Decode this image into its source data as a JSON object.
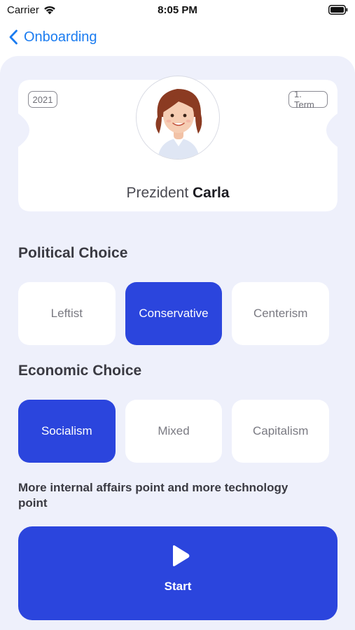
{
  "status_bar": {
    "carrier": "Carrier",
    "time": "8:05 PM"
  },
  "nav": {
    "back_label": "Onboarding"
  },
  "card": {
    "year": "2021",
    "term": "1. Term",
    "title_prefix": "Prezident",
    "name": "Carla",
    "avatar_icon": "woman-avatar-icon"
  },
  "political": {
    "title": "Political Choice",
    "options": [
      "Leftist",
      "Conservative",
      "Centerism"
    ],
    "selected": "Conservative"
  },
  "economic": {
    "title": "Economic Choice",
    "options": [
      "Socialism",
      "Mixed",
      "Capitalism"
    ],
    "selected": "Socialism"
  },
  "description": "More internal affairs point and more technology point",
  "start": {
    "label": "Start",
    "icon": "play-icon"
  },
  "colors": {
    "accent": "#2b45dd",
    "link": "#1b7cf0",
    "panel_bg": "#eef0fb"
  }
}
